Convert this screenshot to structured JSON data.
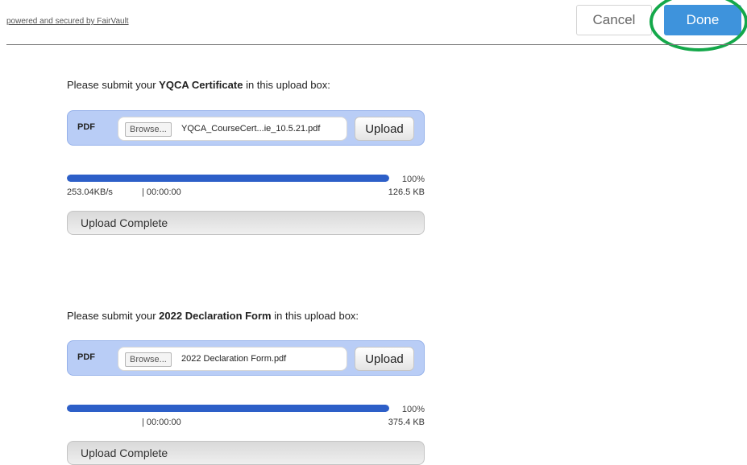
{
  "header": {
    "powered_text": "powered and secured by FairVault",
    "cancel_label": "Cancel",
    "done_label": "Done"
  },
  "uploads": [
    {
      "prompt_before": "Please submit your ",
      "prompt_bold": "YQCA Certificate",
      "prompt_after": " in this upload box:",
      "type_label": "PDF",
      "browse_label": "Browse...",
      "filename": "YQCA_CourseCert...ie_10.5.21.pdf",
      "upload_label": "Upload",
      "progress_percent": 100,
      "percent_text": "100%",
      "speed": "253.04KB/s",
      "time": "| 00:00:00",
      "size": "126.5 KB",
      "status": "Upload Complete"
    },
    {
      "prompt_before": "Please submit your ",
      "prompt_bold": "2022 Declaration Form",
      "prompt_after": " in this upload box:",
      "type_label": "PDF",
      "browse_label": "Browse...",
      "filename": "2022 Declaration Form.pdf",
      "upload_label": "Upload",
      "progress_percent": 100,
      "percent_text": "100%",
      "speed": "",
      "time": "| 00:00:00",
      "size": "375.4 KB",
      "status": "Upload Complete"
    }
  ],
  "colors": {
    "done_button": "#3e93dc",
    "highlight_ring": "#14a84a",
    "upload_box": "#b9cdf6",
    "progress": "#2d5fc8"
  }
}
